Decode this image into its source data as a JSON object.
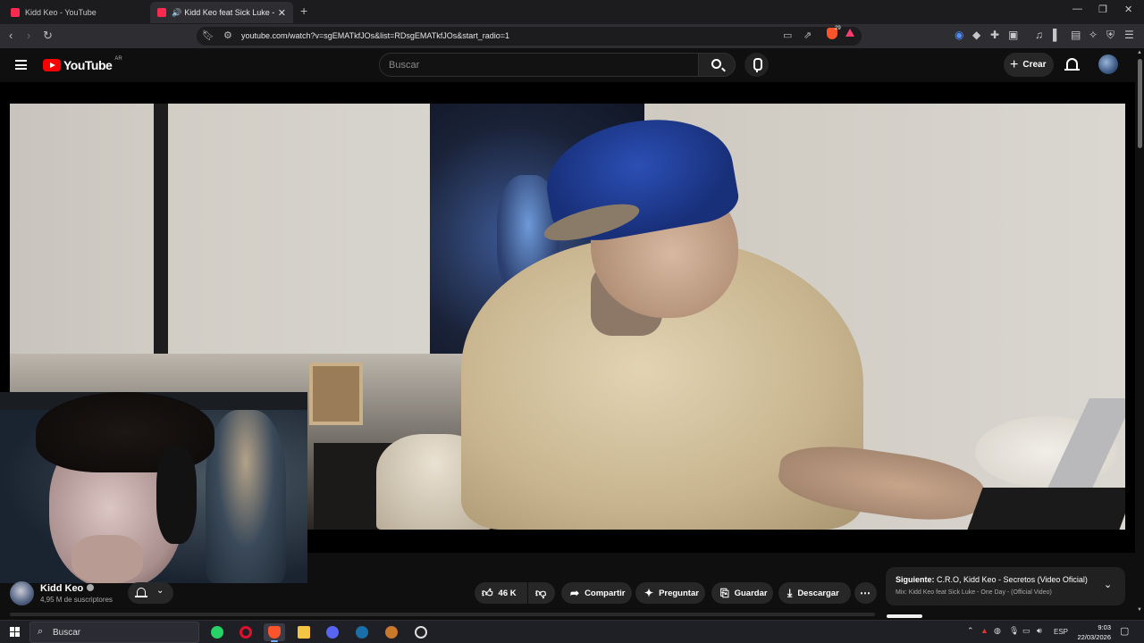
{
  "browser": {
    "tabs": [
      {
        "title": "Kidd Keo - YouTube",
        "active": false
      },
      {
        "title": "Kidd Keo feat Sick Luke - One",
        "active": true
      }
    ],
    "url": "youtube.com/watch?v=sgEMATkfJOs&list=RDsgEMATkfJOs&start_radio=1",
    "brave_badge": "29"
  },
  "youtube": {
    "logo_text": "YouTube",
    "country_code": "AR",
    "search_placeholder": "Buscar",
    "create_label": "Crear"
  },
  "video": {
    "channel_name": "Kidd Keo",
    "subscribers": "4,95 M de suscriptores",
    "likes": "46 K",
    "actions": {
      "share": "Compartir",
      "ask": "Preguntar",
      "save": "Guardar",
      "download": "Descargar"
    }
  },
  "up_next": {
    "prefix": "Siguiente:",
    "title": "C.R.O, Kidd Keo - Secretos (Video Oficial)",
    "mix": "Mix: Kidd Keo feat Sick Luke - One Day - (Official Video)"
  },
  "taskbar": {
    "search_label": "Buscar",
    "language": "ESP",
    "time": "9:03",
    "date": "22/03/2026",
    "apps": [
      "whatsapp",
      "opera",
      "brave",
      "file-explorer",
      "discord",
      "steam",
      "game",
      "obs"
    ]
  },
  "colors": {
    "youtube_red": "#ff0000",
    "background": "#0f0f0f",
    "chip": "#272727"
  }
}
